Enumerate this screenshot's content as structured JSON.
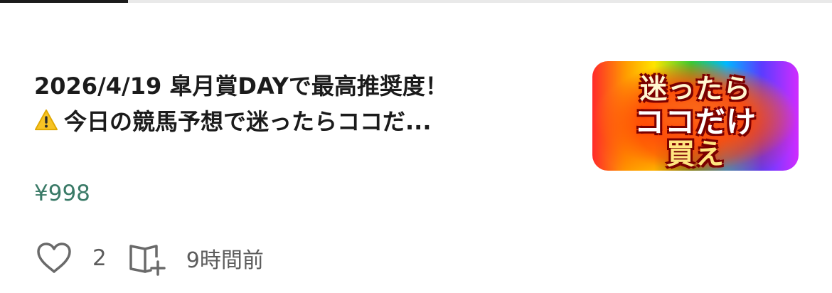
{
  "article": {
    "title_line1": "2026/4/19 皐月賞DAYで最高推奨度！",
    "title_line2": "今日の競馬予想で迷ったらココだ...",
    "title_icon": "warning-icon",
    "price": "¥998",
    "likes": "2",
    "posted": "9時間前",
    "thumbnail": {
      "line1": "迷ったら",
      "line2": "ココだけ",
      "line3": "買え"
    }
  },
  "colors": {
    "price": "#3a7a67",
    "title": "#1b1b1b",
    "meta": "#5c5c5c"
  },
  "icons": {
    "like": "heart-outline-icon",
    "save": "magazine-add-icon"
  }
}
